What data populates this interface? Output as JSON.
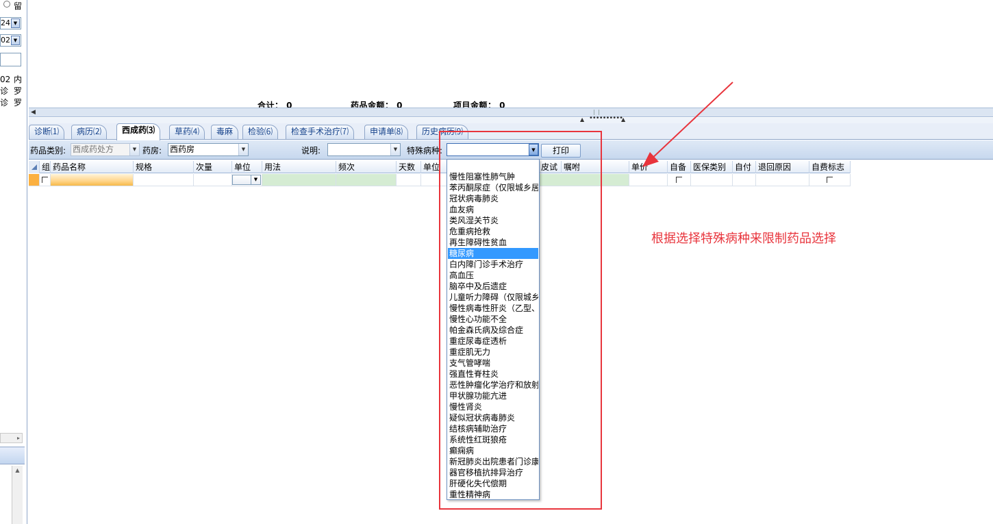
{
  "left_panel": {
    "radio_label": "留",
    "combo1_value": "24",
    "combo2_value": "02",
    "rows": [
      {
        "a": "02",
        "b": "内"
      },
      {
        "a": "诊",
        "b": "罗"
      },
      {
        "a": "诊",
        "b": "罗"
      }
    ]
  },
  "totals": {
    "total": "合计： 0",
    "drug_amount": "药品金额： 0",
    "item_amount": "项目金额： 0"
  },
  "tabs": [
    {
      "label": "诊断⑴"
    },
    {
      "label": "病历⑵"
    },
    {
      "label": "西成药⑶"
    },
    {
      "label": "草药⑷"
    },
    {
      "label": "毒麻"
    },
    {
      "label": "检验⑹"
    },
    {
      "label": "检查手术治疗⑺"
    },
    {
      "label": "申请单⑻"
    },
    {
      "label": "历史病历⑼"
    }
  ],
  "filter": {
    "drug_category_label": "药品类别:",
    "drug_category_value": "西成药处方",
    "pharmacy_label": "药房:",
    "pharmacy_value": "西药房",
    "note_label": "说明:",
    "note_value": "",
    "special_disease_label": "特殊病种:",
    "special_disease_value": "",
    "print_label": "打印"
  },
  "grid": {
    "columns": [
      "组",
      "药品名称",
      "规格",
      "次量",
      "单位",
      "用法",
      "频次",
      "天数",
      "单位",
      "皮试",
      "嘱咐",
      "单价",
      "自备",
      "医保类别",
      "自付",
      "退回原因",
      "自费标志"
    ]
  },
  "dropdown": {
    "selected_index": 7,
    "items": [
      "慢性阻塞性肺气肿",
      "苯丙酮尿症（仅限城乡居",
      "冠状病毒肺炎",
      "血友病",
      "类风湿关节炎",
      "危重病抢救",
      "再生障碍性贫血",
      "糖尿病",
      "白内障门诊手术治疗",
      "高血压",
      "脑卒中及后遗症",
      "儿童听力障碍（仅限城乡",
      "慢性病毒性肝炎（乙型、",
      "慢性心功能不全",
      "帕金森氏病及综合症",
      "重症尿毒症透析",
      "重症肌无力",
      "支气管哮喘",
      "强直性脊柱炎",
      "恶性肿瘤化学治疗和放射",
      "甲状腺功能亢进",
      "慢性肾炎",
      "疑似冠状病毒肺炎",
      "结核病辅助治疗",
      "系统性红斑狼疮",
      "癫痫病",
      "新冠肺炎出院患者门诊康",
      "器官移植抗排异治疗",
      "肝硬化失代偿期",
      "重性精神病"
    ]
  },
  "annotation": {
    "text": "根据选择特殊病种来限制药品选择",
    "color": "#e8343c"
  },
  "colors": {
    "selection": "#3399ff",
    "editable_cell": "#d5ecd3",
    "active_cell": "#ffd58a"
  }
}
